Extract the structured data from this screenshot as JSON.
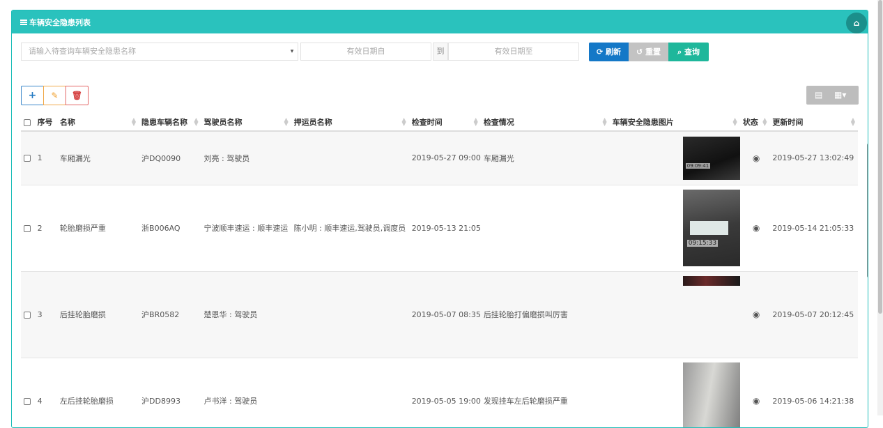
{
  "panel": {
    "title": "车辆安全隐患列表",
    "home_icon": "home-icon"
  },
  "search": {
    "name_placeholder": "请输入待查询车辆安全隐患名称",
    "date_from_placeholder": "有效日期自",
    "to_label": "到",
    "date_to_placeholder": "有效日期至",
    "refresh_label": "刷新",
    "reset_label": "重置",
    "query_label": "查询"
  },
  "toolbar": {
    "add_icon": "plus-icon",
    "edit_icon": "edit-icon",
    "delete_icon": "trash-icon"
  },
  "table": {
    "headers": [
      "序号",
      "名称",
      "隐患车辆名称",
      "驾驶员名称",
      "押运员名称",
      "检查时间",
      "检查情况",
      "车辆安全隐患图片",
      "状态",
      "更新时间"
    ],
    "rows": [
      {
        "no": "1",
        "name": "车厢漏光",
        "vehicle": "沪DQ0090",
        "driver": "刘亮 : 驾驶员",
        "escort": "",
        "check_time": "2019-05-27 09:00",
        "situation": "车厢漏光",
        "has_image": true,
        "update_time": "2019-05-27 13:02:49"
      },
      {
        "no": "2",
        "name": "轮胎磨损严重",
        "vehicle": "浙B006AQ",
        "driver": "宁波顺丰速运 : 顺丰速运",
        "escort": "陈小明 : 顺丰速运,驾驶员,调度员",
        "check_time": "2019-05-13 21:05",
        "situation": "",
        "has_image": true,
        "update_time": "2019-05-14 21:05:33"
      },
      {
        "no": "3",
        "name": "后挂轮胎磨损",
        "vehicle": "沪BR0582",
        "driver": "楚恩华 : 驾驶员",
        "escort": "",
        "check_time": "2019-05-07 08:35",
        "situation": "后挂轮胎打偏磨损叫厉害",
        "has_image": true,
        "update_time": "2019-05-07 20:12:45"
      },
      {
        "no": "4",
        "name": "左后挂轮胎磨损",
        "vehicle": "沪DD8993",
        "driver": "卢书洋 : 驾驶员",
        "escort": "",
        "check_time": "2019-05-05 19:00",
        "situation": "发现挂车左后轮磨损严重",
        "has_image": true,
        "update_time": "2019-05-06 14:21:38"
      }
    ],
    "image_timestamps": [
      "09:09:41",
      "09:15:33"
    ]
  },
  "colors": {
    "header": "#2ac2bd",
    "refresh": "#1478c7",
    "reset": "#c3c3c3",
    "query": "#1eb79b"
  }
}
